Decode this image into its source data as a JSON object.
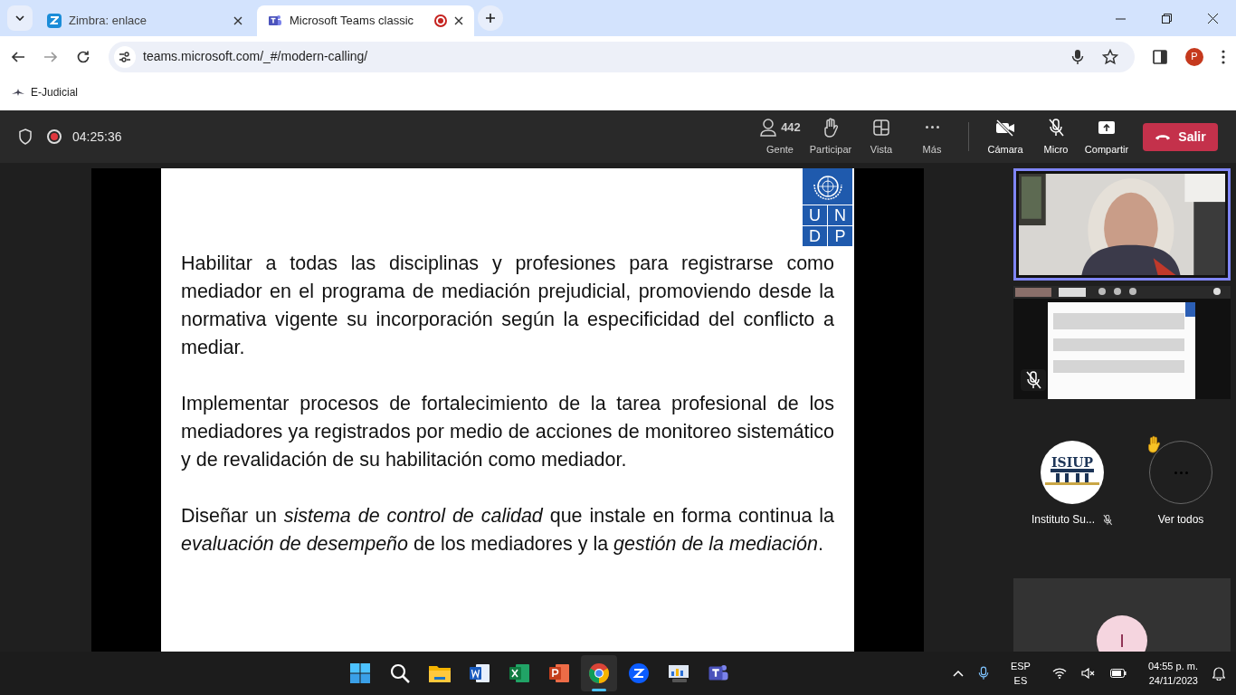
{
  "browser": {
    "tabs": [
      {
        "title": "Zimbra: enlace",
        "kind": "zimbra",
        "selected": false,
        "recording": false
      },
      {
        "title": "Microsoft Teams classic",
        "kind": "teams",
        "selected": true,
        "recording": true
      }
    ],
    "url": "teams.microsoft.com/_#/modern-calling/",
    "profile_initial": "P",
    "bookmarks": [
      {
        "label": "E-Judicial"
      }
    ]
  },
  "meeting": {
    "elapsed": "04:25:36",
    "recording": true,
    "toolbar": [
      {
        "kind": "people",
        "label": "Gente",
        "count": "442"
      },
      {
        "kind": "hand",
        "label": "Participar"
      },
      {
        "kind": "view",
        "label": "Vista"
      },
      {
        "kind": "more",
        "label": "Más"
      },
      {
        "kind": "camera",
        "label": "Cámara",
        "off": true
      },
      {
        "kind": "mic",
        "label": "Micro",
        "off": true
      },
      {
        "kind": "share",
        "label": "Compartir"
      }
    ],
    "leave": "Salir"
  },
  "slide": {
    "logo_letters": [
      "U",
      "N",
      "D",
      "P"
    ],
    "paragraphs": [
      "Habilitar a todas las disciplinas y profesiones para registrarse como mediador en el programa de mediación prejudicial, promoviendo desde la normativa vigente su incorporación según la especificidad del conflicto a mediar.",
      "Implementar procesos de fortalecimiento de la tarea profesional de los mediadores ya registrados por medio de acciones de monitoreo sistemático y de revalidación de su habilitación como mediador.",
      "Diseñar un *sistema de control de calidad* que instale en forma continua la *evaluación de desempeño* de los mediadores y la *gestión de la mediación*."
    ]
  },
  "participants": [
    {
      "name": "Instituto Su...",
      "logo_text": "ISIUP",
      "muted": true
    }
  ],
  "more": {
    "label": "Ver todos",
    "raised_hand": true
  },
  "self": {
    "initial": "I"
  },
  "taskbar": {
    "apps": [
      {
        "kind": "start",
        "selected": false
      },
      {
        "kind": "search",
        "selected": false
      },
      {
        "kind": "files",
        "selected": false
      },
      {
        "kind": "word",
        "selected": false
      },
      {
        "kind": "excel",
        "selected": false
      },
      {
        "kind": "powerpoint",
        "selected": false
      },
      {
        "kind": "chrome",
        "selected": true
      },
      {
        "kind": "zoom",
        "selected": false
      },
      {
        "kind": "presenter",
        "selected": false
      },
      {
        "kind": "teams",
        "selected": false
      }
    ],
    "lang": "ESP",
    "lang2": "ES",
    "time": "04:55 p. m.",
    "date": "24/11/2023"
  }
}
